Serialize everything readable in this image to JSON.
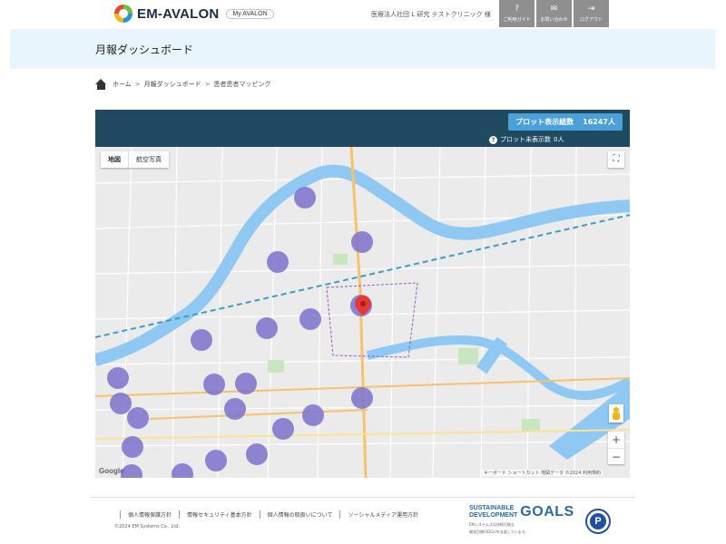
{
  "header": {
    "logo_text": "EM-AVALON",
    "my_avalon": "My AVALON",
    "clinic_name": "医療法人社団 L 研究 テストクリニック 様",
    "buttons": [
      {
        "label": "ご利用ガイド",
        "icon": "help-icon"
      },
      {
        "label": "お問い合わせ",
        "icon": "mail-icon"
      },
      {
        "label": "ログアウト",
        "icon": "logout-icon"
      }
    ]
  },
  "page": {
    "title": "月報ダッシュボード"
  },
  "breadcrumb": {
    "items": [
      "ホーム",
      "月報ダッシュボード",
      "患者患者マッピング"
    ],
    "separator": ">"
  },
  "map_panel": {
    "plot_total_label": "プロット表示総数",
    "plot_total_value": "16247人",
    "plot_missing_label": "プロット未表示数",
    "plot_missing_value": "0人",
    "map_type": [
      "地図",
      "航空写真"
    ],
    "google": "Google",
    "attribution": "キーボード ショートカット  地図データ ©2024  利用規約",
    "colors": {
      "header": "#1f4a62",
      "total_badge": "#4aa0d8",
      "cluster": "#7b72cc",
      "marker": "#e53935",
      "river": "#8fc8f2"
    }
  },
  "footer": {
    "links": [
      "個人情報保護方針",
      "情報セキュリティ基本方針",
      "個人情報の取扱いについて",
      "ソーシャルメディア運用方針"
    ],
    "copyright": "©2024 EM Systems Co., Ltd.",
    "sdgs_small": [
      "SUSTAINABLE",
      "DEVELOPMENT"
    ],
    "sdgs_goals": "GOALS",
    "sdgs_note": [
      "EMシステムズは持続可能な",
      "開発目標(SDGs)を支援しています。"
    ],
    "badge_letter": "P"
  }
}
